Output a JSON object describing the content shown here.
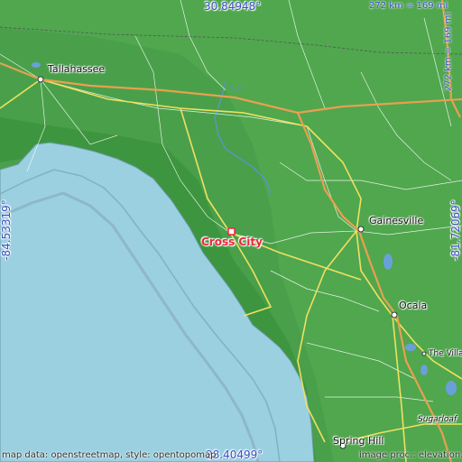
{
  "map": {
    "place_name": "Cross City",
    "lat_top": "30.84948°",
    "lat_bottom": "28.40499°",
    "lon_left": "-84.53319°",
    "lon_right": "-81.72069°",
    "scale_horizontal": "272 km = 169 mi",
    "scale_vertical": "272 km = 169 mi",
    "credit_left": "map data: openstreetmap, style: opentopomap",
    "credit_right": "image proc.: elevation.city",
    "colors": {
      "land": "#4aa04a",
      "lowland": "#3f963f",
      "sea": "#9ad0e0",
      "road_major": "#f0e060",
      "road_highway": "#e8a050",
      "river": "#6090d0",
      "marker": "#e8283a"
    }
  },
  "cities": [
    {
      "name": "Tallahassee"
    },
    {
      "name": "Gainesville"
    },
    {
      "name": "Ocala"
    },
    {
      "name": "The Villages"
    },
    {
      "name": "Sugarloaf"
    },
    {
      "name": "Spring Hill"
    }
  ]
}
